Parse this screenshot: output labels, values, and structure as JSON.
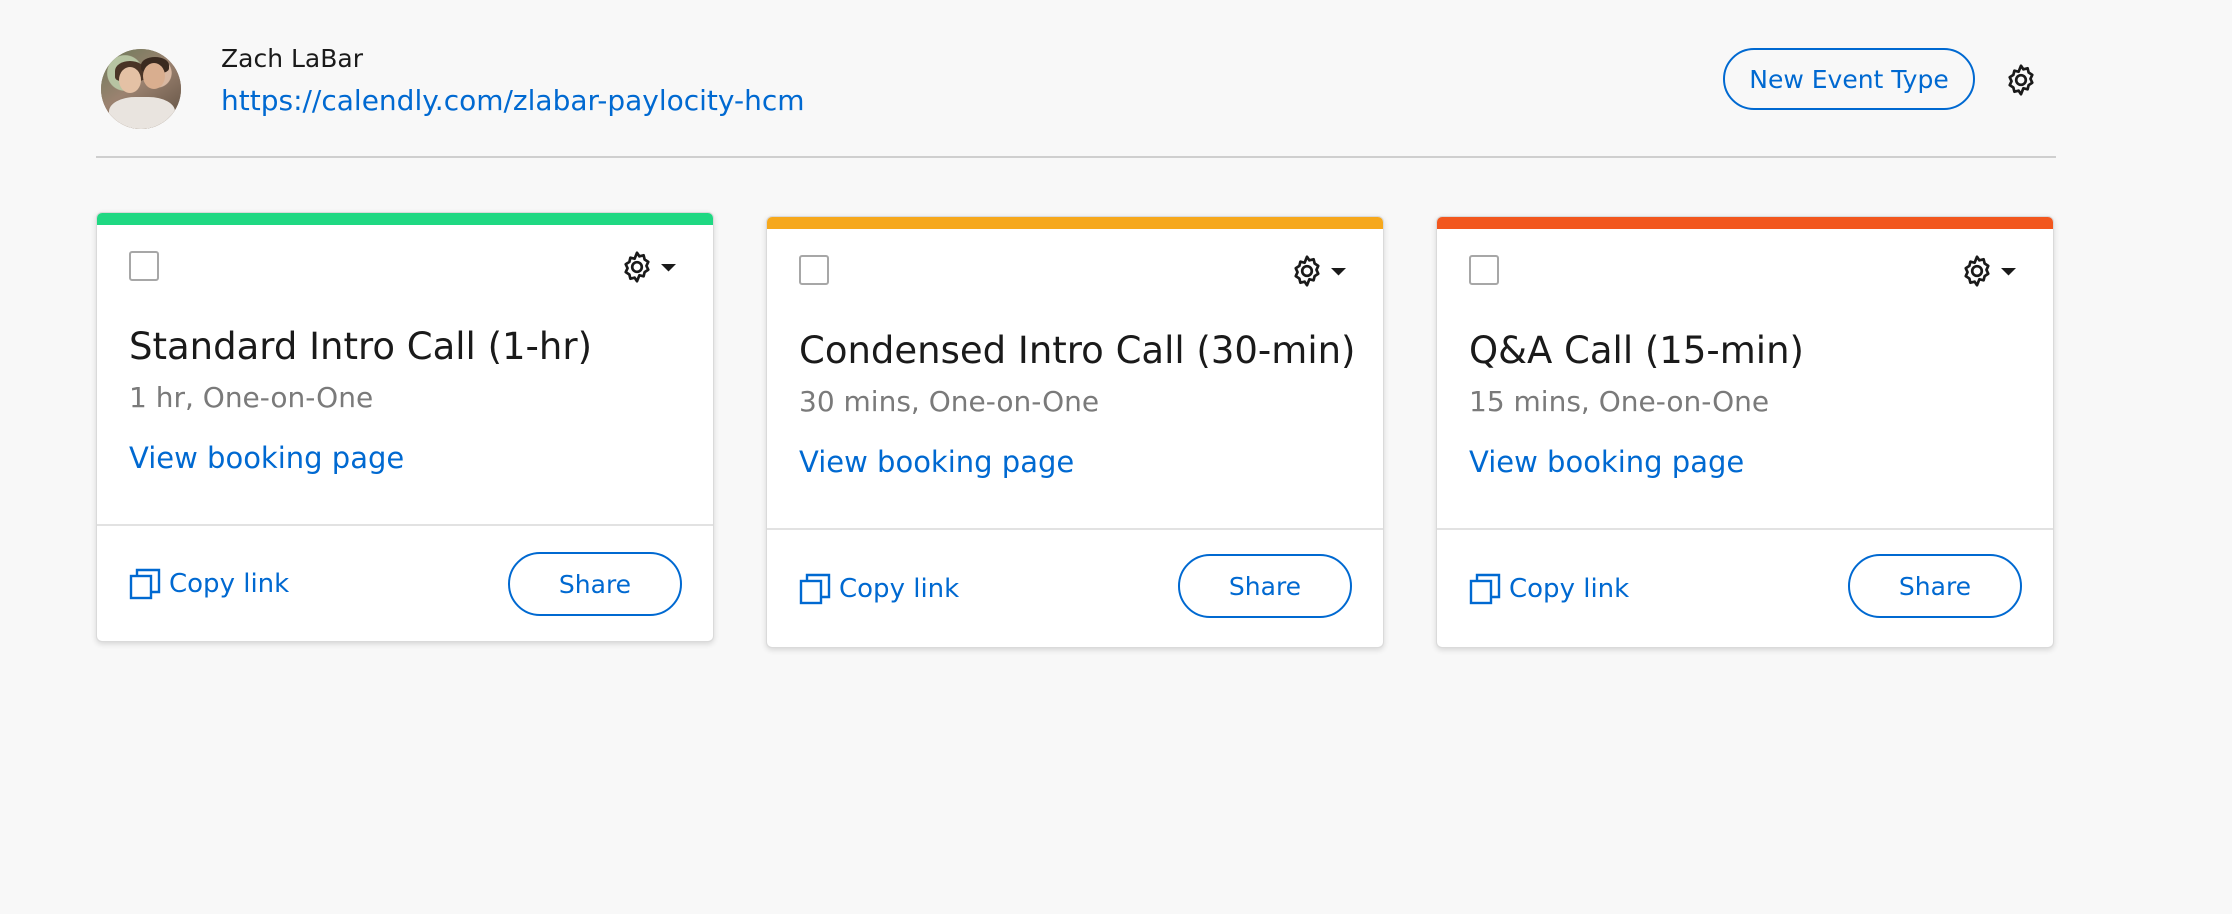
{
  "user": {
    "name": "Zach LaBar",
    "url": "https://calendly.com/zlabar-paylocity-hcm"
  },
  "header": {
    "new_event_label": "New Event Type",
    "settings_icon": "gear-icon"
  },
  "colors": {
    "link_blue": "#0069d1",
    "card_1_accent": "#1fd882",
    "card_2_accent": "#f6a81c",
    "card_3_accent": "#f2571e"
  },
  "event_types": [
    {
      "title": "Standard Intro Call (1-hr)",
      "details": "1 hr, One-on-One",
      "booking_link": "View booking page",
      "copy_label": "Copy link",
      "share_label": "Share",
      "accent": "#1fd882"
    },
    {
      "title": "Condensed Intro Call (30-min)",
      "details": "30 mins, One-on-One",
      "booking_link": "View booking page",
      "copy_label": "Copy link",
      "share_label": "Share",
      "accent": "#f6a81c"
    },
    {
      "title": "Q&A Call (15-min)",
      "details": "15 mins, One-on-One",
      "booking_link": "View booking page",
      "copy_label": "Copy link",
      "share_label": "Share",
      "accent": "#f2571e"
    }
  ]
}
